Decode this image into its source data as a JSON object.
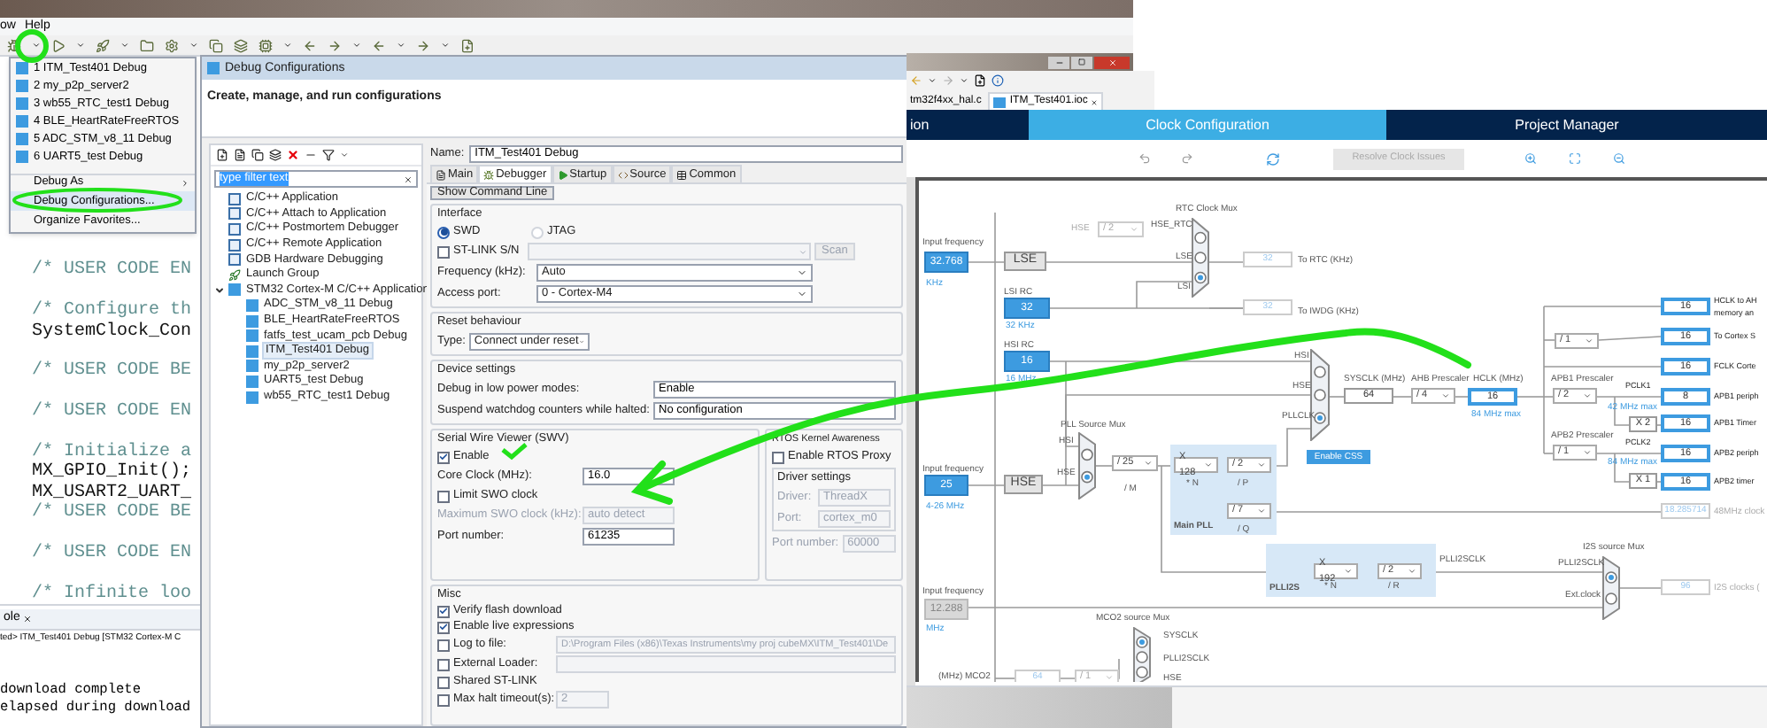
{
  "ide": {
    "menu": [
      "ow",
      "Help"
    ],
    "favorites_menu": [
      {
        "kind": "config",
        "label": "1 ITM_Test401 Debug",
        "selected": false
      },
      {
        "kind": "config",
        "label": "2 my_p2p_server2",
        "selected": false
      },
      {
        "kind": "config",
        "label": "3 wb55_RTC_test1 Debug",
        "selected": false
      },
      {
        "kind": "config",
        "label": "4 BLE_HeartRateFreeRTOS",
        "selected": false
      },
      {
        "kind": "config",
        "label": "5 ADC_STM_v8_11 Debug",
        "selected": false
      },
      {
        "kind": "config",
        "label": "6 UART5_test Debug",
        "selected": false
      },
      {
        "kind": "submenu",
        "label": "Debug As",
        "selected": false
      },
      {
        "kind": "action",
        "label": "Debug Configurations...",
        "selected": true
      },
      {
        "kind": "action",
        "label": "Organize Favorites...",
        "selected": false
      }
    ],
    "code_lines": [
      {
        "kind": "blank"
      },
      {
        "kind": "comment",
        "text": "/* USER CODE EN"
      },
      {
        "kind": "blank"
      },
      {
        "kind": "comment",
        "text": "/* Configure th"
      },
      {
        "kind": "code",
        "text": "SystemClock_Con"
      },
      {
        "kind": "blank"
      },
      {
        "kind": "comment",
        "text": "/* USER CODE BE"
      },
      {
        "kind": "blank"
      },
      {
        "kind": "comment",
        "text": "/* USER CODE EN"
      },
      {
        "kind": "blank"
      },
      {
        "kind": "comment",
        "text": "/* Initialize a"
      },
      {
        "kind": "code",
        "text": "MX_GPIO_Init();"
      },
      {
        "kind": "code",
        "text": "MX_USART2_UART_"
      },
      {
        "kind": "comment",
        "text": "/* USER CODE BE"
      },
      {
        "kind": "blank"
      },
      {
        "kind": "comment",
        "text": "/* USER CODE EN"
      },
      {
        "kind": "blank"
      },
      {
        "kind": "comment",
        "text": "/* Infinite loo"
      }
    ],
    "console": {
      "tab": "ole",
      "status": "ted> ITM_Test401 Debug [STM32 Cortex-M C",
      "lines": [
        "download complete",
        "elapsed during download"
      ]
    }
  },
  "dialog": {
    "title": "Debug Configurations",
    "heading": "Create, manage, and run configurations",
    "filter": {
      "value": "type filter text"
    },
    "tree": [
      {
        "kind": "c",
        "label": "C/C++ Application",
        "selected": false
      },
      {
        "kind": "c",
        "label": "C/C++ Attach to Application",
        "selected": false
      },
      {
        "kind": "c",
        "label": "C/C++ Postmortem Debugger",
        "selected": false
      },
      {
        "kind": "c",
        "label": "C/C++ Remote Application",
        "selected": false
      },
      {
        "kind": "c",
        "label": "GDB Hardware Debugging",
        "selected": false
      },
      {
        "kind": "launch",
        "label": "Launch Group",
        "selected": false
      },
      {
        "kind": "ide",
        "label": "STM32 Cortex-M C/C++ Application",
        "selected": false,
        "expanded": true,
        "children": [
          {
            "kind": "ide",
            "label": "ADC_STM_v8_11 Debug",
            "selected": false
          },
          {
            "kind": "ide",
            "label": "BLE_HeartRateFreeRTOS",
            "selected": false
          },
          {
            "kind": "ide",
            "label": "fatfs_test_ucam_pcb Debug",
            "selected": false
          },
          {
            "kind": "ide",
            "label": "ITM_Test401 Debug",
            "selected": true
          },
          {
            "kind": "ide",
            "label": "my_p2p_server2",
            "selected": false
          },
          {
            "kind": "ide",
            "label": "UART5_test Debug",
            "selected": false
          },
          {
            "kind": "ide",
            "label": "wb55_RTC_test1 Debug",
            "selected": false
          }
        ]
      }
    ],
    "name": {
      "label": "Name:",
      "value": "ITM_Test401 Debug"
    },
    "tabs": [
      {
        "kind": "main",
        "label": "Main",
        "selected": false
      },
      {
        "kind": "debugger",
        "label": "Debugger",
        "selected": true
      },
      {
        "kind": "startup",
        "label": "Startup",
        "selected": false
      },
      {
        "kind": "source",
        "label": "Source",
        "selected": false
      },
      {
        "kind": "common",
        "label": "Common",
        "selected": false
      }
    ],
    "show_command_line": "Show Command Line",
    "interface": {
      "title": "Interface",
      "modes": [
        {
          "label": "SWD",
          "selected": true
        },
        {
          "label": "JTAG",
          "selected": false
        }
      ],
      "stlink": {
        "label": "ST-LINK S/N",
        "checked": false
      },
      "scan": {
        "label": "Scan",
        "disabled": true
      },
      "fields": [
        {
          "label": "Frequency (kHz):",
          "value": "Auto"
        },
        {
          "label": "Access port:",
          "value": "0 - Cortex-M4"
        }
      ]
    },
    "reset": {
      "title": "Reset behaviour",
      "label": "Type:",
      "value": "Connect under reset"
    },
    "device": {
      "title": "Device settings",
      "rows": [
        {
          "label": "Debug in low power modes:",
          "value": "Enable"
        },
        {
          "label": "Suspend watchdog counters while halted:",
          "value": "No configuration"
        }
      ]
    },
    "swv": {
      "title": "Serial Wire Viewer (SWV)",
      "enable": {
        "label": "Enable",
        "checked": true
      },
      "core_clock": {
        "label": "Core Clock (MHz):",
        "value": "16.0"
      },
      "limit": {
        "label": "Limit SWO clock",
        "checked": false
      },
      "max_swo": {
        "label": "Maximum SWO clock (kHz):",
        "value": "auto detect",
        "disabled": true
      },
      "port": {
        "label": "Port number:",
        "value": "61235"
      }
    },
    "rtos": {
      "title": "RTOS Kernel Awareness",
      "proxy": {
        "label": "Enable RTOS Proxy",
        "checked": false
      },
      "driver_settings": "Driver settings",
      "fields": [
        {
          "label": "Driver:",
          "value": "ThreadX",
          "disabled": true
        },
        {
          "label": "Port:",
          "value": "cortex_m0",
          "disabled": true
        }
      ],
      "port_number": {
        "label": "Port number:",
        "value": "60000",
        "disabled": true
      }
    },
    "misc": {
      "title": "Misc",
      "options": [
        {
          "kind": "check",
          "label": "Verify flash download",
          "checked": true
        },
        {
          "kind": "check",
          "label": "Enable live expressions",
          "checked": true
        },
        {
          "kind": "check_field",
          "label": "Log to file:",
          "checked": false,
          "value": "D:\\Program Files (x86)\\Texas Instruments\\my proj cubeMX\\ITM_Test401\\De"
        },
        {
          "kind": "check_field",
          "label": "External Loader:",
          "checked": false
        },
        {
          "kind": "check",
          "label": "Shared ST-LINK",
          "checked": false
        },
        {
          "kind": "check_short",
          "label": "Max halt timeout(s):",
          "checked": false,
          "value": "2"
        }
      ]
    }
  },
  "cubemx": {
    "file_tabs": [
      {
        "label": "tm32f4xx_hal.c",
        "selected": false
      },
      {
        "label": "ITM_Test401.ioc",
        "selected": true
      }
    ],
    "nav": [
      {
        "label": "ion",
        "selected": false
      },
      {
        "label": "Clock Configuration",
        "selected": true
      },
      {
        "label": "Project Manager",
        "selected": false
      }
    ],
    "resolve": {
      "label": "Resolve Clock Issues",
      "disabled": true
    },
    "diagram": {
      "elements": [
        {
          "kind": "label",
          "text": "RTC Clock Mux"
        },
        {
          "kind": "dimlabel",
          "text": "HSE"
        },
        {
          "kind": "select_dim",
          "text": "/ 2"
        },
        {
          "kind": "label",
          "text": "HSE_RTC"
        },
        {
          "kind": "mux",
          "inputs": [
            {
              "selected": false
            },
            {
              "selected": false
            },
            {
              "selected": true
            }
          ]
        },
        {
          "kind": "label",
          "text": "LSE"
        },
        {
          "kind": "label",
          "text": "LSI"
        },
        {
          "kind": "field_dim",
          "text": "32"
        },
        {
          "kind": "label",
          "text": "To RTC (KHz)"
        },
        {
          "kind": "label",
          "text": "Input frequency"
        },
        {
          "kind": "source",
          "text": "32.768"
        },
        {
          "kind": "sublabel",
          "text": "KHz"
        },
        {
          "kind": "block",
          "text": "LSE"
        },
        {
          "kind": "label",
          "text": "LSI RC"
        },
        {
          "kind": "source",
          "text": "32"
        },
        {
          "kind": "sublabel",
          "text": "32 KHz"
        },
        {
          "kind": "field_dim",
          "text": "32"
        },
        {
          "kind": "label",
          "text": "To IWDG (KHz)"
        },
        {
          "kind": "label",
          "text": "HSI RC"
        },
        {
          "kind": "source",
          "text": "16"
        },
        {
          "kind": "sublabel",
          "text": "16 MHz"
        },
        {
          "kind": "label",
          "text": "Input frequency"
        },
        {
          "kind": "source",
          "text": "25"
        },
        {
          "kind": "sublabel",
          "text": "4-26 MHz"
        },
        {
          "kind": "block",
          "text": "HSE"
        },
        {
          "kind": "label",
          "text": "PLL Source Mux"
        },
        {
          "kind": "mux",
          "inputs": [
            {
              "selected": false
            },
            {
              "selected": true
            }
          ]
        },
        {
          "kind": "label",
          "text": "HSI"
        },
        {
          "kind": "label",
          "text": "HSE"
        },
        {
          "kind": "select",
          "text": "/ 25"
        },
        {
          "kind": "label",
          "text": "/ M"
        },
        {
          "kind": "region",
          "text": "Main PLL"
        },
        {
          "kind": "select",
          "text": "X 128"
        },
        {
          "kind": "label",
          "text": "* N"
        },
        {
          "kind": "select",
          "text": "/ 2"
        },
        {
          "kind": "label",
          "text": "/ P"
        },
        {
          "kind": "select",
          "text": "/ 7"
        },
        {
          "kind": "label",
          "text": "/ Q"
        },
        {
          "kind": "mux",
          "inputs": [
            {
              "selected": false
            },
            {
              "selected": false
            },
            {
              "selected": true
            }
          ]
        },
        {
          "kind": "label",
          "text": "HSI"
        },
        {
          "kind": "label",
          "text": "HSE"
        },
        {
          "kind": "label",
          "text": "PLLCLK"
        },
        {
          "kind": "button",
          "text": "Enable CSS"
        },
        {
          "kind": "label",
          "text": "SYSCLK (MHz)"
        },
        {
          "kind": "field",
          "text": "64"
        },
        {
          "kind": "label",
          "text": "AHB Prescaler"
        },
        {
          "kind": "select",
          "text": "/ 4"
        },
        {
          "kind": "label",
          "text": "HCLK (MHz)"
        },
        {
          "kind": "field_hl",
          "text": "16"
        },
        {
          "kind": "sublabel",
          "text": "84 MHz max"
        },
        {
          "kind": "select",
          "text": "/ 1"
        },
        {
          "kind": "label",
          "text": "APB1 Prescaler"
        },
        {
          "kind": "select",
          "text": "/ 2"
        },
        {
          "kind": "outlabel",
          "text": "PCLK1"
        },
        {
          "kind": "sublabel",
          "text": "42 MHz max"
        },
        {
          "kind": "field",
          "text": "X 2"
        },
        {
          "kind": "label",
          "text": "APB2 Prescaler"
        },
        {
          "kind": "select",
          "text": "/ 1"
        },
        {
          "kind": "outlabel",
          "text": "PCLK2"
        },
        {
          "kind": "sublabel",
          "text": "84 MHz max"
        },
        {
          "kind": "field",
          "text": "X 1"
        },
        {
          "kind": "field_out",
          "text": "16"
        },
        {
          "kind": "outlabel",
          "text": "HCLK to AH"
        },
        {
          "kind": "outlabel",
          "text": "memory an"
        },
        {
          "kind": "field_out",
          "text": "16"
        },
        {
          "kind": "outlabel",
          "text": "To Cortex S"
        },
        {
          "kind": "field_out",
          "text": "16"
        },
        {
          "kind": "outlabel",
          "text": "FCLK Corte"
        },
        {
          "kind": "field_out",
          "text": "8"
        },
        {
          "kind": "outlabel",
          "text": "APB1 periph"
        },
        {
          "kind": "field_out",
          "text": "16"
        },
        {
          "kind": "outlabel",
          "text": "APB1 Timer"
        },
        {
          "kind": "field_out",
          "text": "16"
        },
        {
          "kind": "outlabel",
          "text": "APB2 periph"
        },
        {
          "kind": "field_out",
          "text": "16"
        },
        {
          "kind": "outlabel",
          "text": "APB2 timer"
        },
        {
          "kind": "field_dim",
          "text": "18.285714"
        },
        {
          "kind": "dimlabel",
          "text": "48MHz clock"
        },
        {
          "kind": "region",
          "text": "PLLI2S"
        },
        {
          "kind": "select",
          "text": "X 192"
        },
        {
          "kind": "label",
          "text": "* N"
        },
        {
          "kind": "select",
          "text": "/ 2"
        },
        {
          "kind": "label",
          "text": "/ R"
        },
        {
          "kind": "label",
          "text": "PLLI2SCLK"
        },
        {
          "kind": "label",
          "text": "I2S source Mux"
        },
        {
          "kind": "mux",
          "inputs": [
            {
              "selected": true
            },
            {
              "selected": false
            }
          ]
        },
        {
          "kind": "label",
          "text": "PLLI2SCLK"
        },
        {
          "kind": "label",
          "text": "Ext.clock"
        },
        {
          "kind": "field_dim",
          "text": "96"
        },
        {
          "kind": "dimlabel",
          "text": "I2S clocks ("
        },
        {
          "kind": "label",
          "text": "Input frequency"
        },
        {
          "kind": "source_dim",
          "text": "12.288"
        },
        {
          "kind": "sublabel",
          "text": "MHz"
        },
        {
          "kind": "label",
          "text": "(MHz) MCO2"
        },
        {
          "kind": "field_dim",
          "text": "64"
        },
        {
          "kind": "select_dim",
          "text": "/ 1"
        },
        {
          "kind": "label",
          "text": "MCO2 source Mux"
        },
        {
          "kind": "mux",
          "inputs": [
            {
              "selected": true
            },
            {
              "selected": false
            },
            {
              "selected": false
            }
          ]
        },
        {
          "kind": "label",
          "text": "SYSCLK"
        },
        {
          "kind": "label",
          "text": "PLLI2SCLK"
        },
        {
          "kind": "label",
          "text": "HSE"
        }
      ]
    }
  }
}
